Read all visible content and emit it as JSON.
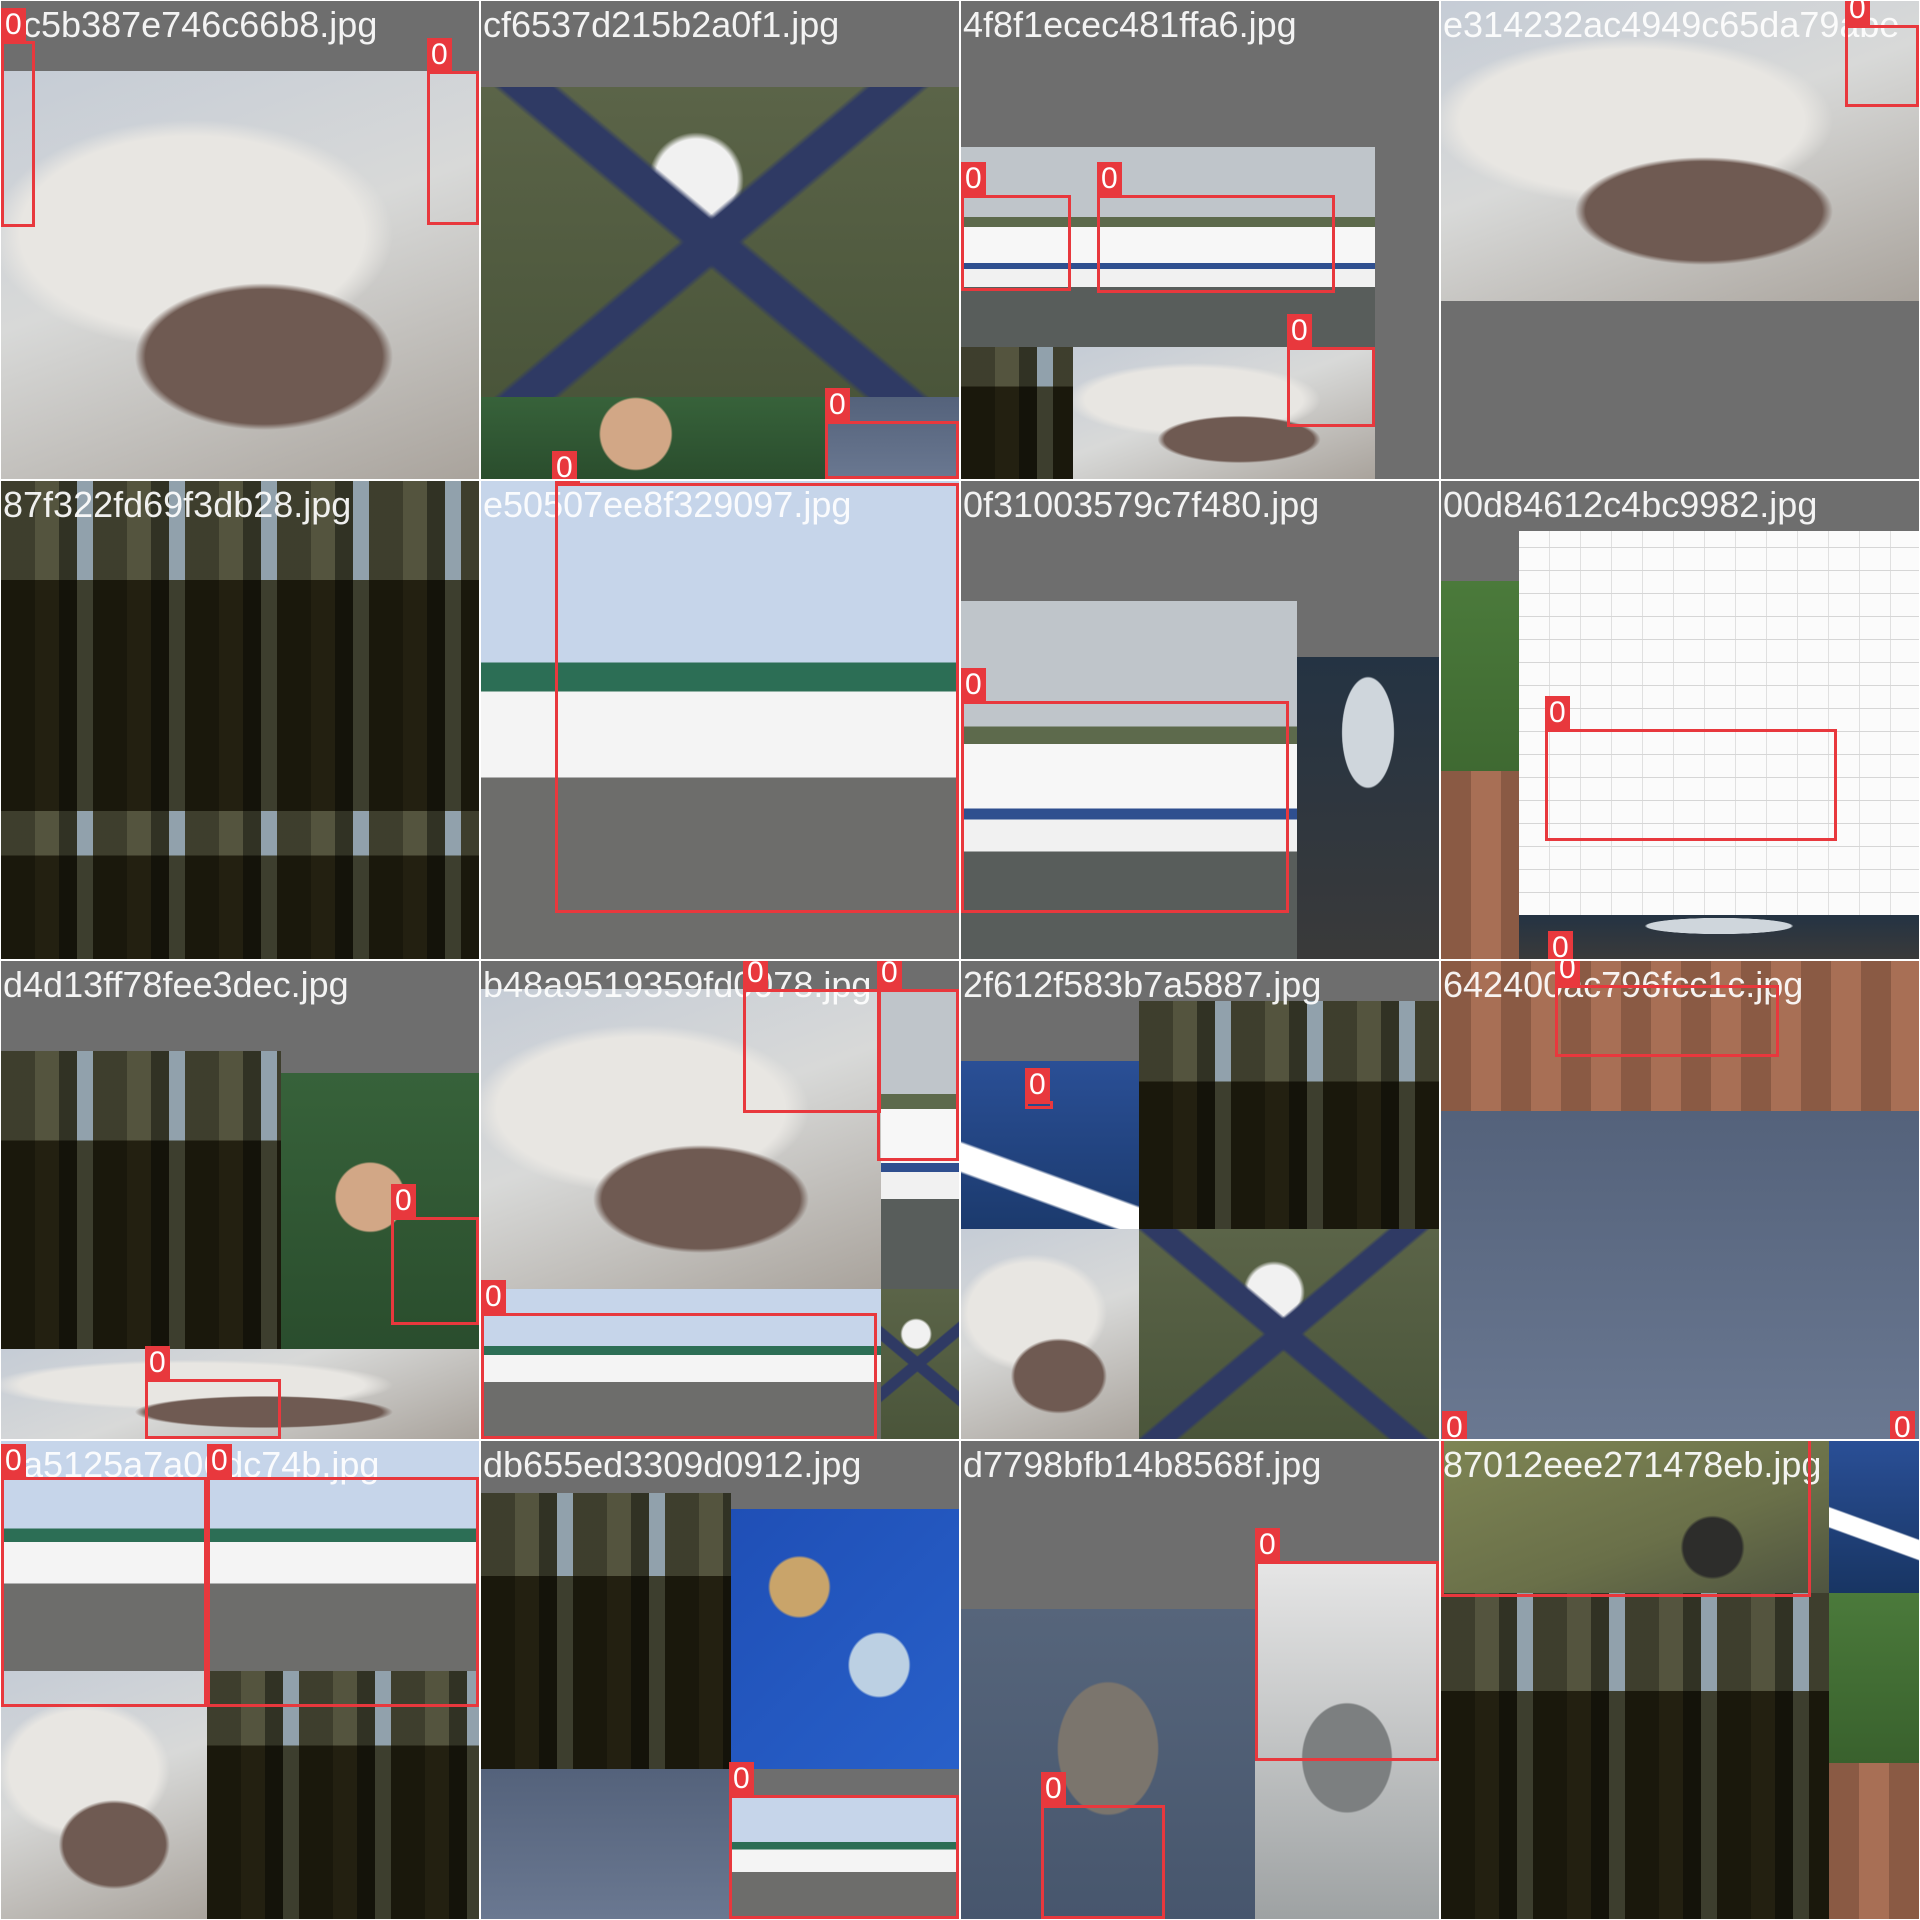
{
  "tiles": [
    {
      "filename": "dc5b387e746c66b8.jpg",
      "labels": [
        "0",
        "0"
      ]
    },
    {
      "filename": "cf6537d215b2a0f1.jpg",
      "labels": [
        "0",
        "0"
      ]
    },
    {
      "filename": "4f8f1ecec481ffa6.jpg",
      "labels": [
        "0",
        "0",
        "0"
      ]
    },
    {
      "filename": "e314232ac4949c65da79abe",
      "labels": [
        "0"
      ]
    },
    {
      "filename": "87f322fd69f3db28.jpg",
      "labels": []
    },
    {
      "filename": "e50507ee8f329097.jpg",
      "labels": [
        "0"
      ]
    },
    {
      "filename": "0f31003579c7f480.jpg",
      "labels": [
        "0"
      ]
    },
    {
      "filename": "00d84612c4bc9982.jpg",
      "labels": [
        "0",
        "0"
      ]
    },
    {
      "filename": "d4d13ff78fee3dec.jpg",
      "labels": [
        "0",
        "0"
      ]
    },
    {
      "filename": "b48a9519359fd0078.jpg",
      "labels": [
        "0",
        "0",
        "0"
      ]
    },
    {
      "filename": "2f612f583b7a5887.jpg",
      "labels": [
        "0"
      ]
    },
    {
      "filename": "642400ac796fcc1c.jpg",
      "labels": [
        "0",
        "0",
        "0"
      ]
    },
    {
      "filename": "1a5125a7a06dc74b.jpg",
      "labels": [
        "0",
        "0"
      ]
    },
    {
      "filename": "db655ed3309d0912.jpg",
      "labels": [
        "0"
      ]
    },
    {
      "filename": "d7798bfb14b8568f.jpg",
      "labels": [
        "0",
        "0"
      ]
    },
    {
      "filename": "87012eee271478eb.jpg",
      "labels": []
    }
  ],
  "colors": {
    "box": "#e8383d",
    "pad": "#6e6e6e"
  }
}
